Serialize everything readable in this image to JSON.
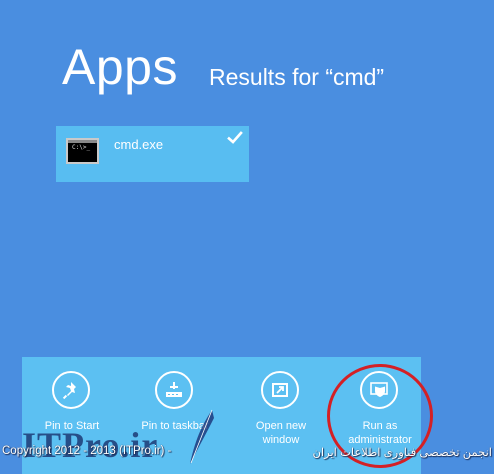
{
  "header": {
    "title": "Apps",
    "results_label": "Results for “cmd”"
  },
  "results": [
    {
      "label": "cmd.exe",
      "icon": "command-prompt-icon",
      "selected": true,
      "prompt_text": "C:\\>_"
    }
  ],
  "app_bar": {
    "commands": [
      {
        "id": "pin-to-start",
        "label_line1": "Pin to Start",
        "label_line2": "",
        "icon": "pin-icon"
      },
      {
        "id": "pin-to-taskbar",
        "label_line1": "Pin to taskbar",
        "label_line2": "",
        "icon": "taskbar-pin-icon"
      },
      {
        "id": "open-new-window",
        "label_line1": "Open new",
        "label_line2": "window",
        "icon": "new-window-icon"
      },
      {
        "id": "run-as-administrator",
        "label_line1": "Run as",
        "label_line2": "administrator",
        "icon": "shield-icon"
      }
    ]
  },
  "watermark": {
    "logo_text": "ITPro.ir",
    "copyright": "Copyright 2012 - 2013 (ITPro.ir) - ",
    "copyright_fa": "انجمن تخصصی فناوری اطلاعات ایران"
  },
  "colors": {
    "background": "#4a8ee0",
    "tile": "#58bdf1",
    "app_bar": "#5cc0f2",
    "annotation": "#d42025"
  }
}
